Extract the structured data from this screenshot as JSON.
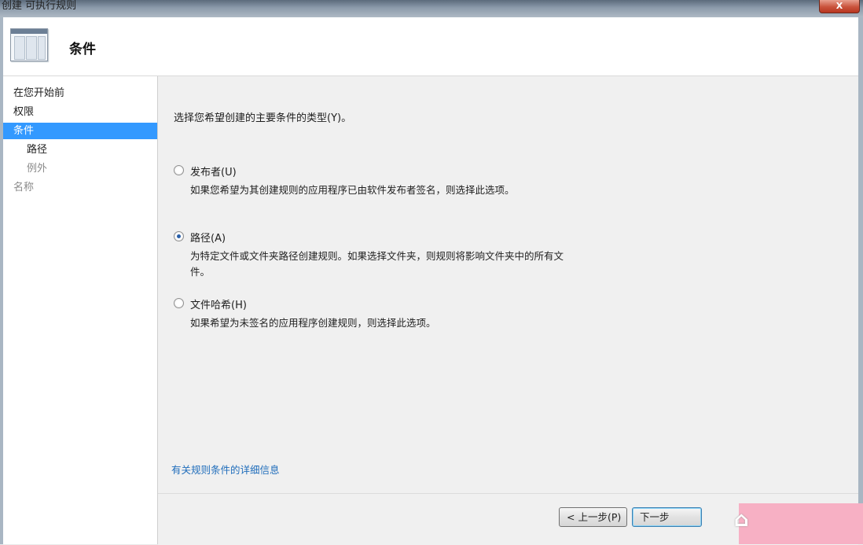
{
  "window": {
    "title": "创建 可执行规则",
    "close": "X"
  },
  "header": {
    "title": "条件"
  },
  "sidebar": {
    "items": [
      {
        "label": "在您开始前"
      },
      {
        "label": "权限"
      },
      {
        "label": "条件"
      },
      {
        "label": "路径"
      },
      {
        "label": "例外"
      },
      {
        "label": "名称"
      }
    ]
  },
  "main": {
    "prompt": "选择您希望创建的主要条件的类型(Y)。",
    "options": [
      {
        "label": "发布者(U)",
        "description": "如果您希望为其创建规则的应用程序已由软件发布者签名，则选择此选项。",
        "checked": false
      },
      {
        "label": "路径(A)",
        "description": "为特定文件或文件夹路径创建规则。如果选择文件夹，则规则将影响文件夹中的所有文件。",
        "checked": true
      },
      {
        "label": "文件哈希(H)",
        "description": "如果希望为未签名的应用程序创建规则，则选择此选项。",
        "checked": false
      }
    ],
    "link": "有关规则条件的详细信息"
  },
  "footer": {
    "prev_label": "< 上一步(P)",
    "next_label": "下一步"
  },
  "colors": {
    "selected": "#3399ff",
    "link": "#1f6dbb",
    "watermark": "#f7b0c4"
  }
}
